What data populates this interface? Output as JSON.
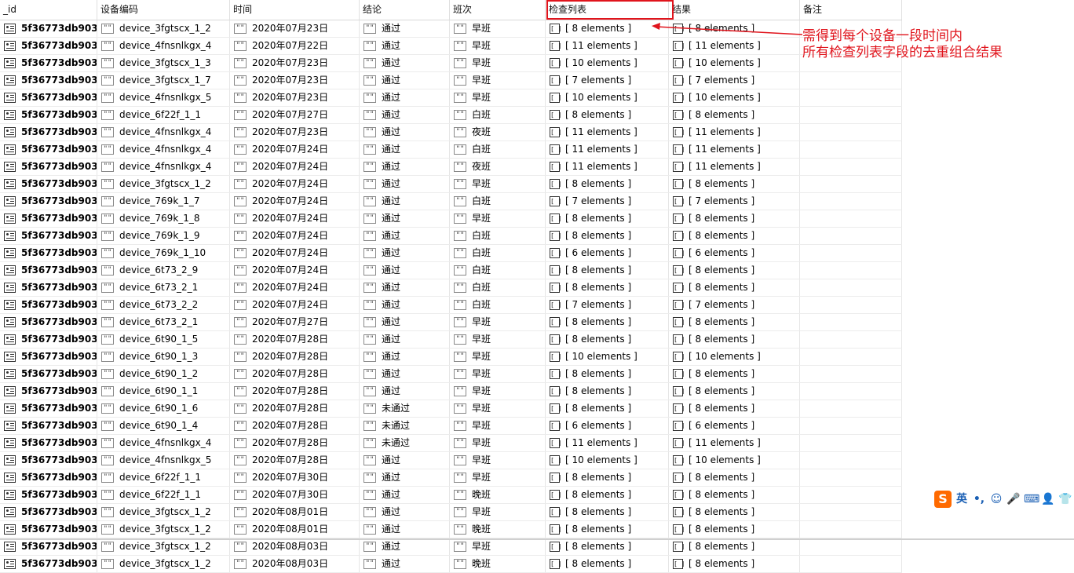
{
  "columns": [
    "_id",
    "设备编码",
    "时间",
    "结论",
    "班次",
    "检查列表",
    "结果",
    "备注"
  ],
  "icons": {
    "id": "document-icon",
    "string": "string-icon",
    "array": "array-icon"
  },
  "icon_glyphs": {
    "string": "\"\"",
    "array": "[ ]"
  },
  "rows": [
    [
      "5f36773db903...",
      "device_3fgtscx_1_2",
      "2020年07月23日",
      "通过",
      "早班",
      "[ 8 elements ]",
      "[ 8 elements ]"
    ],
    [
      "5f36773db903...",
      "device_4fnsnlkgx_4",
      "2020年07月22日",
      "通过",
      "早班",
      "[ 11 elements ]",
      "[ 11 elements ]"
    ],
    [
      "5f36773db903...",
      "device_3fgtscx_1_3",
      "2020年07月23日",
      "通过",
      "早班",
      "[ 10 elements ]",
      "[ 10 elements ]"
    ],
    [
      "5f36773db903...",
      "device_3fgtscx_1_7",
      "2020年07月23日",
      "通过",
      "早班",
      "[ 7 elements ]",
      "[ 7 elements ]"
    ],
    [
      "5f36773db903...",
      "device_4fnsnlkgx_5",
      "2020年07月23日",
      "通过",
      "早班",
      "[ 10 elements ]",
      "[ 10 elements ]"
    ],
    [
      "5f36773db903...",
      "device_6f22f_1_1",
      "2020年07月27日",
      "通过",
      "白班",
      "[ 8 elements ]",
      "[ 8 elements ]"
    ],
    [
      "5f36773db903...",
      "device_4fnsnlkgx_4",
      "2020年07月23日",
      "通过",
      "夜班",
      "[ 11 elements ]",
      "[ 11 elements ]"
    ],
    [
      "5f36773db903...",
      "device_4fnsnlkgx_4",
      "2020年07月24日",
      "通过",
      "白班",
      "[ 11 elements ]",
      "[ 11 elements ]"
    ],
    [
      "5f36773db903...",
      "device_4fnsnlkgx_4",
      "2020年07月24日",
      "通过",
      "夜班",
      "[ 11 elements ]",
      "[ 11 elements ]"
    ],
    [
      "5f36773db903...",
      "device_3fgtscx_1_2",
      "2020年07月24日",
      "通过",
      "早班",
      "[ 8 elements ]",
      "[ 8 elements ]"
    ],
    [
      "5f36773db903...",
      "device_769k_1_7",
      "2020年07月24日",
      "通过",
      "白班",
      "[ 7 elements ]",
      "[ 7 elements ]"
    ],
    [
      "5f36773db903...",
      "device_769k_1_8",
      "2020年07月24日",
      "通过",
      "早班",
      "[ 8 elements ]",
      "[ 8 elements ]"
    ],
    [
      "5f36773db903...",
      "device_769k_1_9",
      "2020年07月24日",
      "通过",
      "白班",
      "[ 8 elements ]",
      "[ 8 elements ]"
    ],
    [
      "5f36773db903...",
      "device_769k_1_10",
      "2020年07月24日",
      "通过",
      "白班",
      "[ 6 elements ]",
      "[ 6 elements ]"
    ],
    [
      "5f36773db903...",
      "device_6t73_2_9",
      "2020年07月24日",
      "通过",
      "白班",
      "[ 8 elements ]",
      "[ 8 elements ]"
    ],
    [
      "5f36773db903...",
      "device_6t73_2_1",
      "2020年07月24日",
      "通过",
      "白班",
      "[ 8 elements ]",
      "[ 8 elements ]"
    ],
    [
      "5f36773db903...",
      "device_6t73_2_2",
      "2020年07月24日",
      "通过",
      "白班",
      "[ 7 elements ]",
      "[ 7 elements ]"
    ],
    [
      "5f36773db903...",
      "device_6t73_2_1",
      "2020年07月27日",
      "通过",
      "早班",
      "[ 8 elements ]",
      "[ 8 elements ]"
    ],
    [
      "5f36773db903...",
      "device_6t90_1_5",
      "2020年07月28日",
      "通过",
      "早班",
      "[ 8 elements ]",
      "[ 8 elements ]"
    ],
    [
      "5f36773db903...",
      "device_6t90_1_3",
      "2020年07月28日",
      "通过",
      "早班",
      "[ 10 elements ]",
      "[ 10 elements ]"
    ],
    [
      "5f36773db903...",
      "device_6t90_1_2",
      "2020年07月28日",
      "通过",
      "早班",
      "[ 8 elements ]",
      "[ 8 elements ]"
    ],
    [
      "5f36773db903...",
      "device_6t90_1_1",
      "2020年07月28日",
      "通过",
      "早班",
      "[ 8 elements ]",
      "[ 8 elements ]"
    ],
    [
      "5f36773db903...",
      "device_6t90_1_6",
      "2020年07月28日",
      "未通过",
      "早班",
      "[ 8 elements ]",
      "[ 8 elements ]"
    ],
    [
      "5f36773db903...",
      "device_6t90_1_4",
      "2020年07月28日",
      "未通过",
      "早班",
      "[ 6 elements ]",
      "[ 6 elements ]"
    ],
    [
      "5f36773db903...",
      "device_4fnsnlkgx_4",
      "2020年07月28日",
      "未通过",
      "早班",
      "[ 11 elements ]",
      "[ 11 elements ]"
    ],
    [
      "5f36773db903...",
      "device_4fnsnlkgx_5",
      "2020年07月28日",
      "通过",
      "早班",
      "[ 10 elements ]",
      "[ 10 elements ]"
    ],
    [
      "5f36773db903...",
      "device_6f22f_1_1",
      "2020年07月30日",
      "通过",
      "早班",
      "[ 8 elements ]",
      "[ 8 elements ]"
    ],
    [
      "5f36773db903...",
      "device_6f22f_1_1",
      "2020年07月30日",
      "通过",
      "晚班",
      "[ 8 elements ]",
      "[ 8 elements ]"
    ],
    [
      "5f36773db903...",
      "device_3fgtscx_1_2",
      "2020年08月01日",
      "通过",
      "早班",
      "[ 8 elements ]",
      "[ 8 elements ]"
    ],
    [
      "5f36773db903...",
      "device_3fgtscx_1_2",
      "2020年08月01日",
      "通过",
      "晚班",
      "[ 8 elements ]",
      "[ 8 elements ]"
    ],
    [
      "5f36773db903...",
      "device_3fgtscx_1_2",
      "2020年08月03日",
      "通过",
      "早班",
      "[ 8 elements ]",
      "[ 8 elements ]"
    ],
    [
      "5f36773db903...",
      "device_3fgtscx_1_2",
      "2020年08月03日",
      "通过",
      "晚班",
      "[ 8 elements ]",
      "[ 8 elements ]"
    ]
  ],
  "annotation": {
    "line1": "需得到每个设备一段时间内",
    "line2": "所有检查列表字段的去重组合结果",
    "color": "#e0141c"
  },
  "ime_toolbar": {
    "logo": "S",
    "lang": "英",
    "punct": "•,",
    "items": [
      "smiley-icon",
      "mic-icon",
      "keyboard-icon",
      "user-icon",
      "shirt-icon"
    ],
    "glyphs": [
      "☺",
      "🎤",
      "⌨",
      "👤",
      "👕"
    ]
  }
}
